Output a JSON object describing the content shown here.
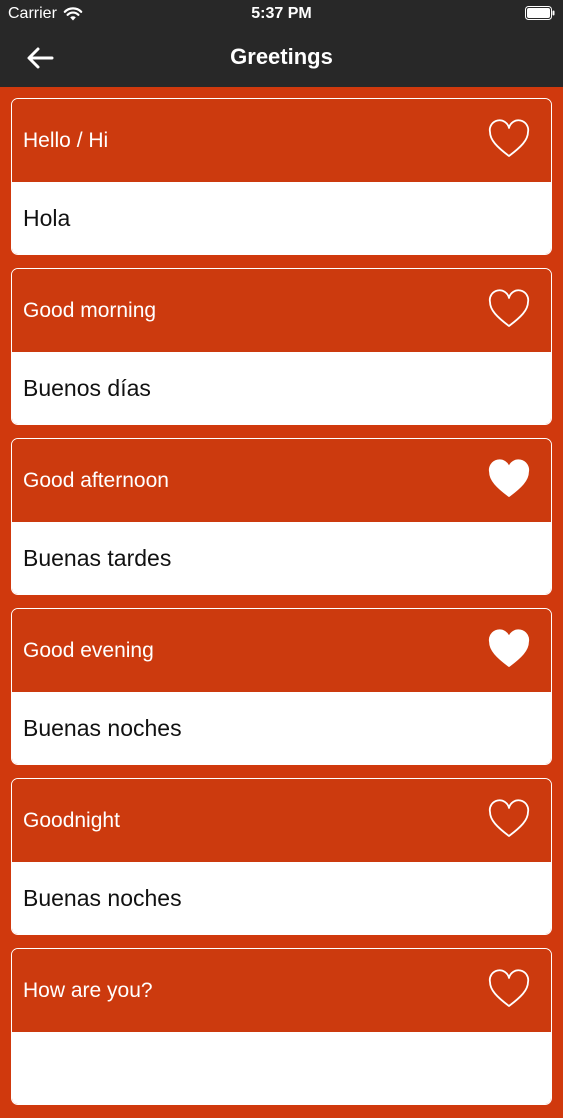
{
  "status_bar": {
    "carrier": "Carrier",
    "time": "5:37 PM"
  },
  "nav": {
    "title": "Greetings",
    "back_icon": "arrow-left-icon"
  },
  "colors": {
    "accent": "#cc3a0e",
    "bar": "#282828",
    "card_bottom": "#ffffff"
  },
  "phrases": [
    {
      "english": "Hello / Hi",
      "spanish": "Hola",
      "favorite": false
    },
    {
      "english": "Good morning",
      "spanish": "Buenos días",
      "favorite": false
    },
    {
      "english": "Good afternoon",
      "spanish": "Buenas tardes",
      "favorite": true
    },
    {
      "english": "Good evening",
      "spanish": "Buenas noches",
      "favorite": true
    },
    {
      "english": "Goodnight",
      "spanish": "Buenas noches",
      "favorite": false
    },
    {
      "english": "How are you?",
      "spanish": "",
      "favorite": false
    }
  ]
}
